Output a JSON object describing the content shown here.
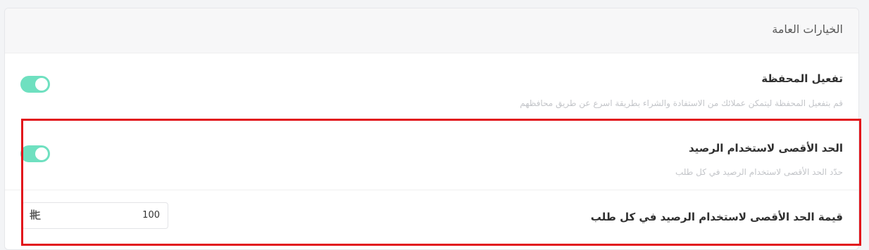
{
  "card": {
    "title": "الخيارات العامة"
  },
  "wallet": {
    "title": "تفعيل المحفظة",
    "description": "قم بتفعيل المحفظة ليتمكن عملائك من الاستفادة والشراء بطريقة اسرع عن طريق محافظهم",
    "enabled": true
  },
  "max_balance": {
    "title": "الحد الأقصى لاستخدام الرصيد",
    "description": "حدّد الحد الأقصى لاستخدام الرصيد في كل طلب",
    "enabled": true
  },
  "max_value": {
    "label": "قيمة الحد الأقصى لاستخدام الرصيد في كل طلب",
    "value": "100",
    "currency_symbol": "⃁"
  },
  "colors": {
    "toggle_on": "#6fe0c0",
    "highlight": "#e2141b"
  }
}
